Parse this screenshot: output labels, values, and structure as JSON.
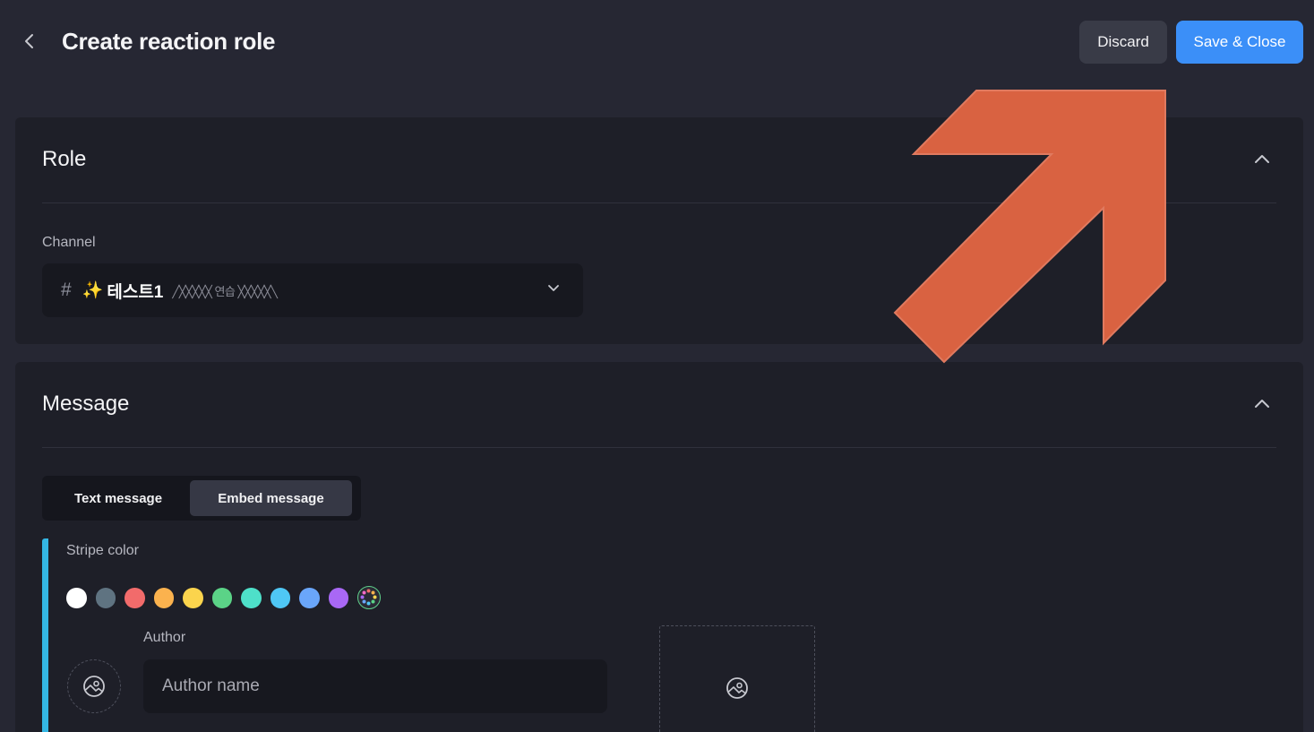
{
  "header": {
    "title": "Create reaction role",
    "back_icon": "chevron-left-icon",
    "discard_label": "Discard",
    "save_label": "Save & Close"
  },
  "role_section": {
    "title": "Role",
    "channel_label": "Channel",
    "channel": {
      "hash": "#",
      "sparkle": "✨",
      "name": "테스트1",
      "decoration": "╱╳╳╳╳╳ 연습 ╳╳╳╳╳╲"
    }
  },
  "message_section": {
    "title": "Message",
    "tabs": [
      {
        "label": "Text message",
        "active": false
      },
      {
        "label": "Embed message",
        "active": true
      }
    ],
    "stripe_color_label": "Stripe color",
    "selected_stripe_color": "#34b6e3",
    "swatch_colors": [
      "#ffffff",
      "#5f7381",
      "#f26b6b",
      "#fbb24e",
      "#fbd44d",
      "#5bd387",
      "#4ee0c9",
      "#4fc7f5",
      "#6aa6fa",
      "#a968f5"
    ],
    "author_label": "Author",
    "author_placeholder": "Author name"
  },
  "colors": {
    "accent": "#3b8ff8",
    "background": "#262733",
    "panel": "#1e1f28",
    "overlay_arrow": "#d96241"
  }
}
